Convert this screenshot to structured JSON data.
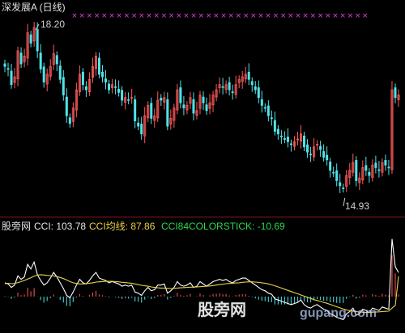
{
  "chart_title": "深发展A (日线)",
  "high_label": "18.20",
  "low_label": "14.93",
  "indicator": {
    "name": "股旁网",
    "cci_label": "CCI: 103.78",
    "cci_ma_label": "CCI均线: 87.86",
    "cci84_label": "CCI84COLORSTICK: -10.69"
  },
  "watermark": {
    "text": "股旁网",
    "url": "gupang.com"
  },
  "colors": {
    "bull": "#ff5a5a",
    "bear": "#4fe3e8",
    "cci": "#ffffff",
    "cci_ma": "#e8d24a",
    "marker": "#e040e0",
    "divider": "#8a1a1a"
  },
  "chart_data": [
    {
      "type": "candlestick",
      "title": "深发展A (日线)",
      "ylim": [
        14.6,
        18.4
      ],
      "annotations": [
        {
          "label": "18.20",
          "value": 18.2
        },
        {
          "label": "14.93",
          "value": 14.93
        }
      ],
      "closes": [
        17.4,
        17.35,
        17.05,
        17.2,
        17.7,
        17.45,
        17.6,
        18.05,
        17.85,
        18.15,
        17.7,
        17.35,
        17.1,
        17.25,
        17.4,
        17.65,
        17.45,
        17.15,
        16.85,
        16.45,
        16.3,
        16.6,
        16.95,
        17.25,
        17.05,
        16.95,
        17.15,
        17.4,
        17.6,
        17.25,
        17.2,
        17.1,
        16.95,
        17.05,
        17.0,
        16.9,
        16.75,
        16.8,
        16.75,
        16.8,
        16.35,
        16.25,
        16.1,
        16.45,
        16.65,
        16.4,
        16.45,
        16.75,
        16.75,
        16.8,
        16.25,
        16.4,
        16.6,
        16.95,
        16.7,
        16.6,
        16.65,
        16.8,
        16.5,
        16.55,
        16.85,
        16.7,
        16.55,
        16.7,
        16.85,
        16.95,
        17.05,
        17.0,
        17.05,
        16.95,
        16.9,
        17.05,
        17.15,
        17.2,
        17.25,
        17.15,
        17.05,
        16.95,
        16.8,
        16.65,
        16.6,
        16.45,
        16.4,
        16.15,
        16.1,
        16.05,
        16.0,
        15.95,
        15.9,
        15.95,
        16.0,
        16.1,
        15.85,
        15.75,
        15.7,
        15.85,
        15.9,
        15.8,
        15.65,
        15.6,
        15.4,
        15.35,
        15.2,
        15.1,
        15.05,
        15.3,
        15.4,
        15.55,
        15.2,
        15.25,
        15.45,
        15.4,
        15.3,
        15.5,
        15.45,
        15.4,
        15.55,
        15.5,
        15.45,
        16.95,
        16.8,
        16.85
      ],
      "cci": [
        60,
        55,
        40,
        50,
        90,
        75,
        85,
        140,
        120,
        150,
        95,
        70,
        50,
        60,
        80,
        105,
        85,
        60,
        35,
        5,
        -5,
        20,
        50,
        75,
        60,
        55,
        70,
        90,
        105,
        80,
        75,
        70,
        60,
        65,
        60,
        55,
        45,
        50,
        45,
        50,
        20,
        15,
        5,
        25,
        40,
        25,
        30,
        50,
        50,
        55,
        15,
        25,
        40,
        65,
        50,
        45,
        50,
        60,
        40,
        45,
        65,
        55,
        45,
        55,
        65,
        70,
        75,
        70,
        75,
        65,
        60,
        70,
        75,
        80,
        80,
        70,
        60,
        50,
        40,
        30,
        25,
        15,
        10,
        -10,
        -15,
        -20,
        -25,
        -30,
        -35,
        -30,
        -25,
        -15,
        -35,
        -45,
        -50,
        -40,
        -35,
        -45,
        -55,
        -60,
        -75,
        -80,
        -90,
        -95,
        -100,
        -75,
        -65,
        -50,
        -80,
        -75,
        -55,
        -60,
        -70,
        -50,
        -55,
        -60,
        -45,
        -50,
        -55,
        250,
        130,
        104
      ],
      "cci_ma": [
        56,
        58,
        56,
        57,
        61,
        65,
        70,
        76,
        82,
        89,
        93,
        95,
        94,
        92,
        91,
        90,
        87,
        83,
        78,
        72,
        65,
        60,
        57,
        55,
        55,
        56,
        58,
        60,
        63,
        64,
        65,
        66,
        66,
        66,
        65,
        64,
        62,
        61,
        59,
        58,
        55,
        52,
        49,
        47,
        45,
        42,
        40,
        38,
        37,
        37,
        36,
        35,
        36,
        37,
        38,
        39,
        40,
        41,
        41,
        42,
        43,
        44,
        45,
        46,
        48,
        50,
        52,
        54,
        56,
        57,
        58,
        59,
        60,
        62,
        63,
        64,
        64,
        63,
        62,
        60,
        58,
        55,
        51,
        47,
        42,
        37,
        32,
        27,
        22,
        17,
        12,
        7,
        2,
        -3,
        -8,
        -13,
        -17,
        -21,
        -25,
        -29,
        -34,
        -39,
        -44,
        -49,
        -54,
        -58,
        -61,
        -63,
        -65,
        -67,
        -68,
        -69,
        -69,
        -68,
        -67,
        -66,
        -65,
        -64,
        -63,
        -50,
        -38,
        88
      ]
    }
  ]
}
